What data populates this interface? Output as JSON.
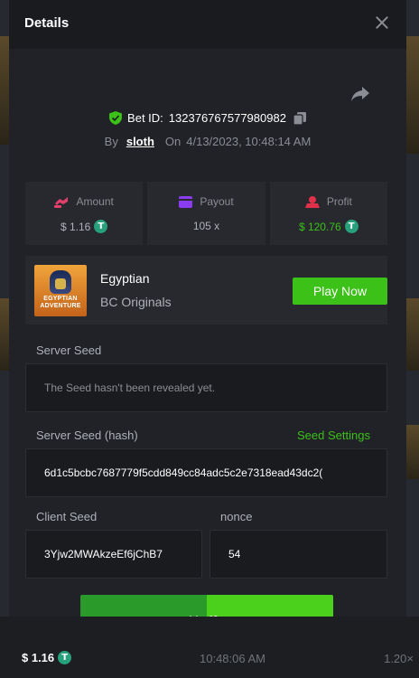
{
  "modal": {
    "title": "Details"
  },
  "bet": {
    "id_label": "Bet ID:",
    "id_value": "132376767577980982",
    "by_label": "By",
    "username": "sloth",
    "on_label": "On",
    "datetime": "4/13/2023, 10:48:14 AM"
  },
  "stats": {
    "amount": {
      "label": "Amount",
      "value": "$ 1.16"
    },
    "payout": {
      "label": "Payout",
      "value": "105 x"
    },
    "profit": {
      "label": "Profit",
      "value": "$ 120.76"
    }
  },
  "game": {
    "name": "Egyptian",
    "provider": "BC Originals",
    "thumb_text": "EGYPTIAN ADVENTURE",
    "play_label": "Play Now"
  },
  "server_seed": {
    "label": "Server Seed",
    "value": "The Seed hasn't been revealed yet."
  },
  "server_seed_hash": {
    "label": "Server Seed (hash)",
    "settings_label": "Seed Settings",
    "value": "6d1c5bcbc7687779f5cdd849cc84adc5c2e7318ead43dc2("
  },
  "client_seed": {
    "label": "Client Seed",
    "value": "3Yjw2MWAkzeEf6jChB7"
  },
  "nonce": {
    "label": "nonce",
    "value": "54"
  },
  "verify_label": "Verify",
  "background_row": {
    "amount": "$ 1.16",
    "time": "10:48:06 AM",
    "multiplier": "1.20×"
  },
  "icons": {
    "tether": "T"
  },
  "colors": {
    "accent_green": "#3bc117",
    "modal_bg": "#202227",
    "card_bg": "#27292e",
    "input_bg": "#1a1b1f",
    "amount_icon": "#e0406a",
    "payout_icon": "#8a3cf0",
    "profit_icon": "#e0304a",
    "tether": "#26a17b"
  }
}
